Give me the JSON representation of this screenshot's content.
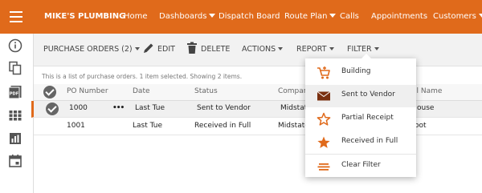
{
  "brand": "MIKE'S PLUMBING",
  "nav": [
    {
      "label": "Home",
      "dropdown": false
    },
    {
      "label": "Dashboards",
      "dropdown": true
    },
    {
      "label": "Dispatch Board",
      "dropdown": false
    },
    {
      "label": "Route Plan",
      "dropdown": true
    },
    {
      "label": "Calls",
      "dropdown": false
    },
    {
      "label": "Appointments",
      "dropdown": false
    },
    {
      "label": "Customers",
      "dropdown": true
    }
  ],
  "sidebar_icons": [
    "info-icon",
    "copy-icon",
    "pdf-icon",
    "grid-icon",
    "chart-icon",
    "calendar-icon"
  ],
  "sidebar_pdf_text": "PDF",
  "toolbar": {
    "purchase_orders": "PURCHASE ORDERS (2)",
    "edit": "EDIT",
    "delete": "DELETE",
    "actions": "ACTIONS",
    "report": "REPORT",
    "filter": "FILTER"
  },
  "info_text": "This is a list of purchase orders. 1 item selected. Showing 2 items.",
  "table": {
    "headers": [
      "PO Number",
      "Date",
      "Status",
      "Compan",
      "ll Name"
    ],
    "rows": [
      {
        "po": "1000",
        "menu": "•••",
        "date": "Last Tue",
        "status": "Sent to Vendor",
        "company": "Midstate",
        "name": "ouse",
        "selected": true
      },
      {
        "po": "1001",
        "menu": "",
        "date": "Last Tue",
        "status": "Received in Full",
        "company": "Midstate",
        "name": "oot",
        "selected": false
      }
    ]
  },
  "filter_menu": [
    {
      "label": "Building",
      "icon": "cart-icon"
    },
    {
      "label": "Sent to Vendor",
      "icon": "envelope-icon"
    },
    {
      "label": "Partial Receipt",
      "icon": "star-outline-icon"
    },
    {
      "label": "Received in Full",
      "icon": "star-filled-icon"
    },
    {
      "label": "Clear Filter",
      "icon": "clear-filter-icon"
    }
  ],
  "colors": {
    "brand": "#e06a1b",
    "icon_orange": "#e06a1b",
    "envelope": "#7a3010"
  }
}
